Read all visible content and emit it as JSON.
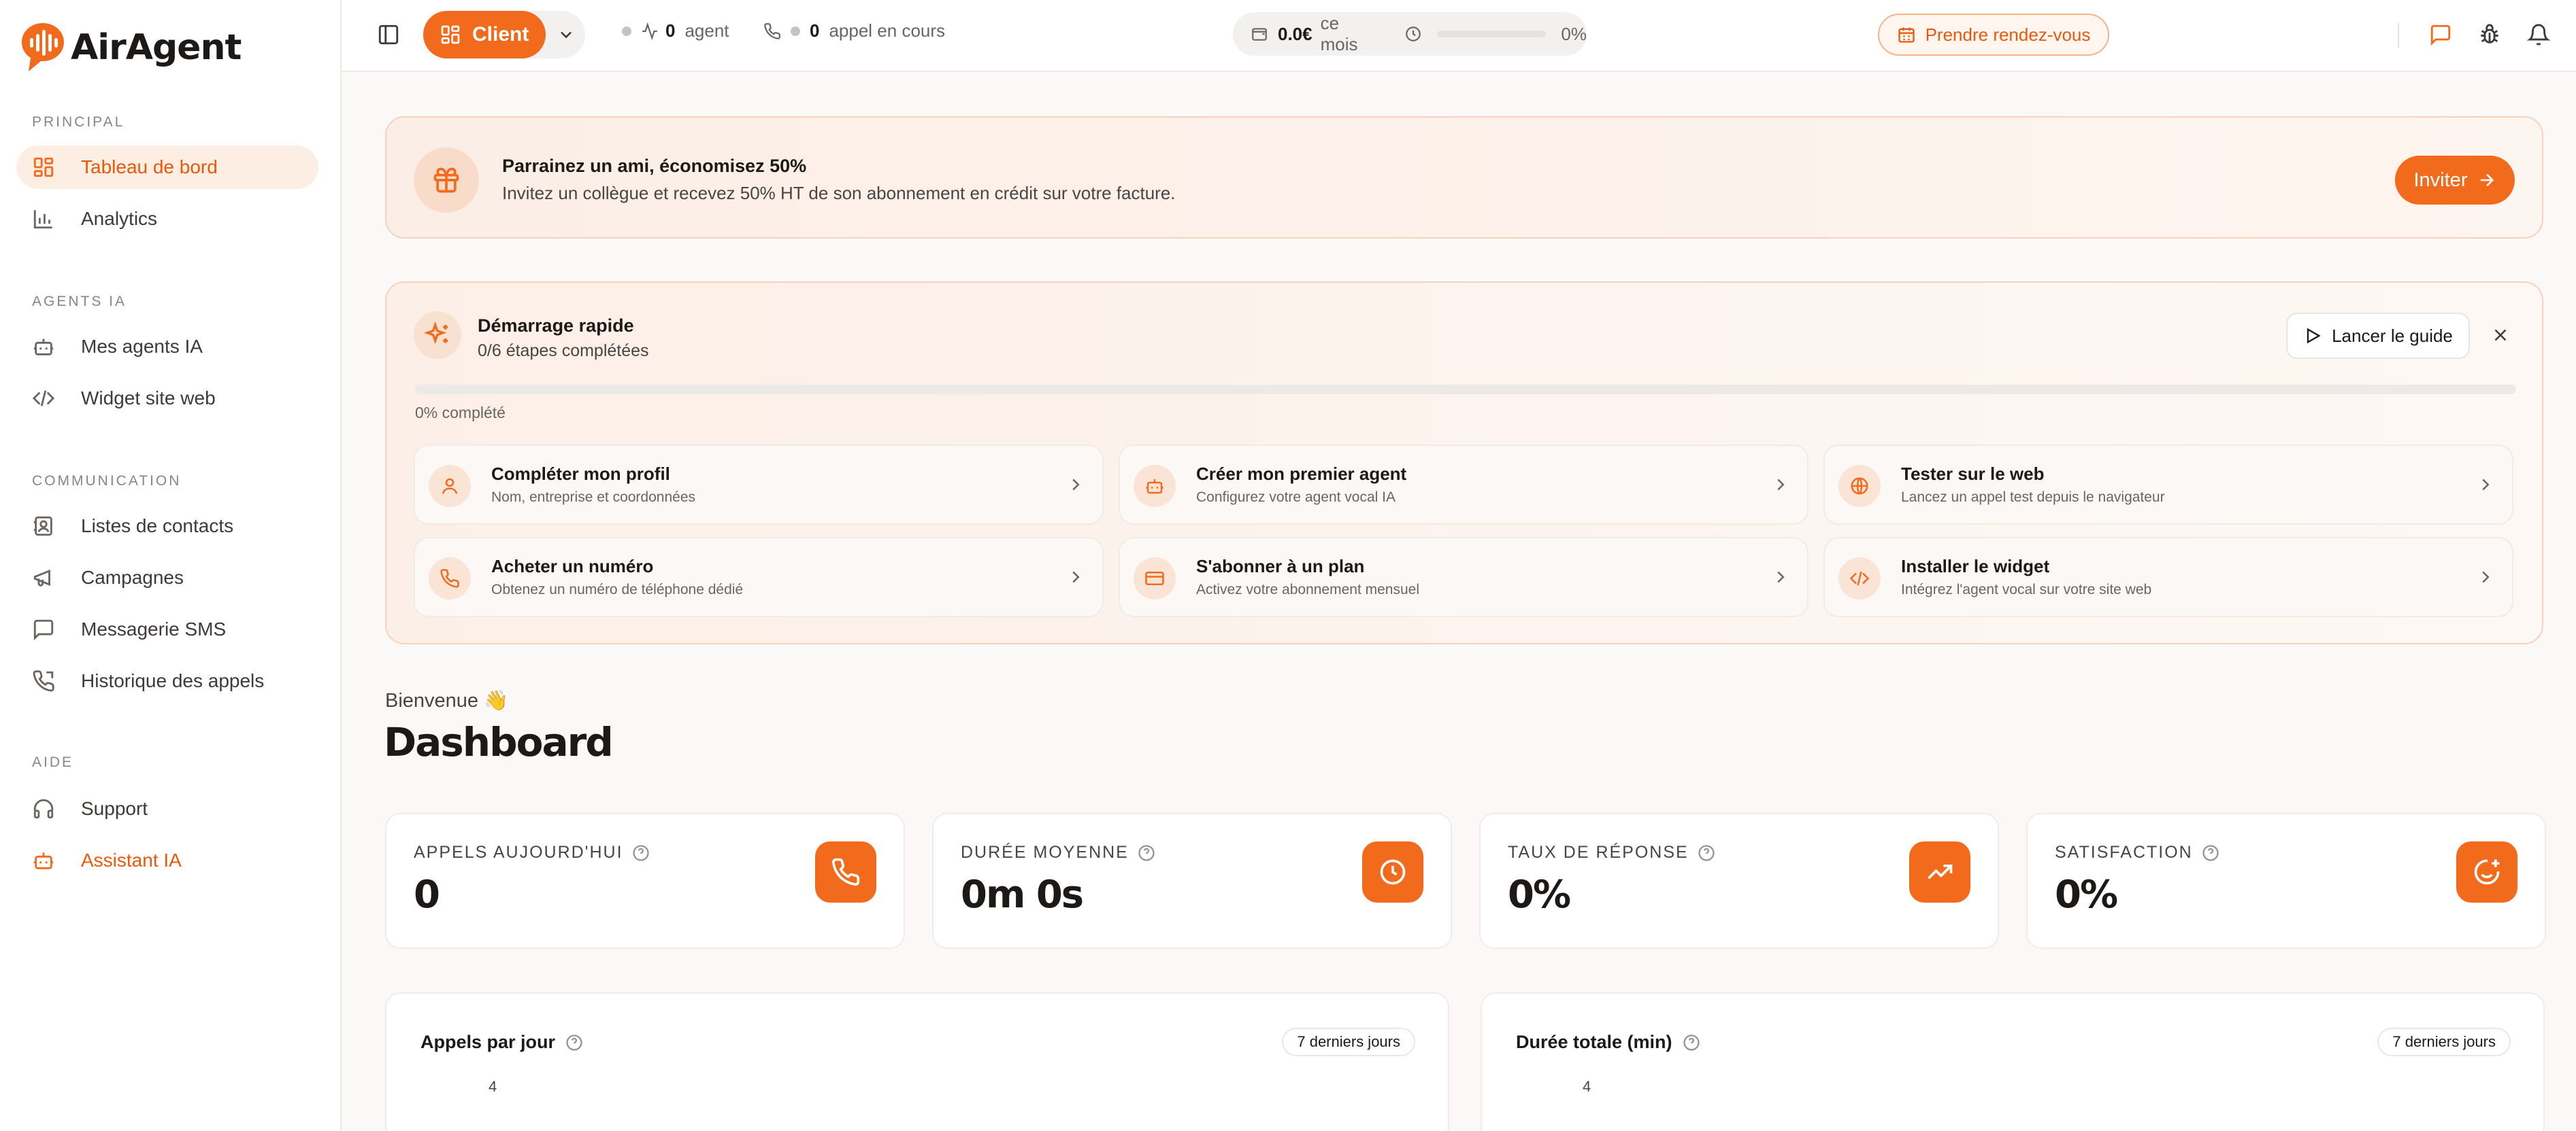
{
  "app": {
    "name": "AirAgent"
  },
  "sidebar": {
    "sections": [
      {
        "label": "PRINCIPAL",
        "items": [
          {
            "label": "Tableau de bord",
            "icon": "grid-icon",
            "active": true
          },
          {
            "label": "Analytics",
            "icon": "bar-chart-icon"
          }
        ]
      },
      {
        "label": "AGENTS IA",
        "items": [
          {
            "label": "Mes agents IA",
            "icon": "bot-icon"
          },
          {
            "label": "Widget site web",
            "icon": "code-icon"
          }
        ]
      },
      {
        "label": "COMMUNICATION",
        "items": [
          {
            "label": "Listes de contacts",
            "icon": "contacts-icon"
          },
          {
            "label": "Campagnes",
            "icon": "megaphone-icon"
          },
          {
            "label": "Messagerie SMS",
            "icon": "message-icon"
          },
          {
            "label": "Historique des appels",
            "icon": "phone-history-icon"
          }
        ]
      },
      {
        "label": "AIDE",
        "items": [
          {
            "label": "Support",
            "icon": "headset-icon"
          },
          {
            "label": "Assistant IA",
            "icon": "bot-icon",
            "accent": true
          }
        ]
      }
    ]
  },
  "topbar": {
    "role_label": "Client",
    "agents_count": "0",
    "agents_label": "agent",
    "calls_count": "0",
    "calls_label": "appel en cours",
    "cost_value": "0.0€",
    "cost_label": "ce mois",
    "usage_percent": "0%",
    "usage_fraction": 0,
    "appointment_label": "Prendre rendez-vous"
  },
  "referral": {
    "title": "Parrainez un ami, économisez 50%",
    "text": "Invitez un collègue et recevez 50% HT de son abonnement en crédit sur votre facture.",
    "button": "Inviter"
  },
  "quickstart": {
    "title": "Démarrage rapide",
    "subtitle": "0/6 étapes complétées",
    "guide_button": "Lancer le guide",
    "progress_text": "0% complété",
    "progress_fraction": 0,
    "steps": [
      {
        "title": "Compléter mon profil",
        "desc": "Nom, entreprise et coordonnées",
        "icon": "user-icon"
      },
      {
        "title": "Créer mon premier agent",
        "desc": "Configurez votre agent vocal IA",
        "icon": "bot-icon"
      },
      {
        "title": "Tester sur le web",
        "desc": "Lancez un appel test depuis le navigateur",
        "icon": "globe-icon"
      },
      {
        "title": "Acheter un numéro",
        "desc": "Obtenez un numéro de téléphone dédié",
        "icon": "phone-icon"
      },
      {
        "title": "S'abonner à un plan",
        "desc": "Activez votre abonnement mensuel",
        "icon": "credit-card-icon"
      },
      {
        "title": "Installer le widget",
        "desc": "Intégrez l'agent vocal sur votre site web",
        "icon": "code-icon"
      }
    ]
  },
  "welcome": {
    "greeting": "Bienvenue 👋",
    "title": "Dashboard"
  },
  "kpis": [
    {
      "label": "APPELS AUJOURD'HUI",
      "value": "0",
      "icon": "phone-icon"
    },
    {
      "label": "DURÉE MOYENNE",
      "value": "0m 0s",
      "icon": "clock-icon"
    },
    {
      "label": "TAUX DE RÉPONSE",
      "value": "0%",
      "icon": "trending-up-icon"
    },
    {
      "label": "SATISFACTION",
      "value": "0%",
      "icon": "smile-plus-icon"
    }
  ],
  "charts": [
    {
      "title": "Appels par jour",
      "range": "7 derniers jours",
      "first_tick": "4"
    },
    {
      "title": "Durée totale (min)",
      "range": "7 derniers jours",
      "first_tick": "4"
    }
  ],
  "colors": {
    "accent": "#f26a1b",
    "accent_soft": "#fdeee4",
    "text": "#1c1917"
  }
}
